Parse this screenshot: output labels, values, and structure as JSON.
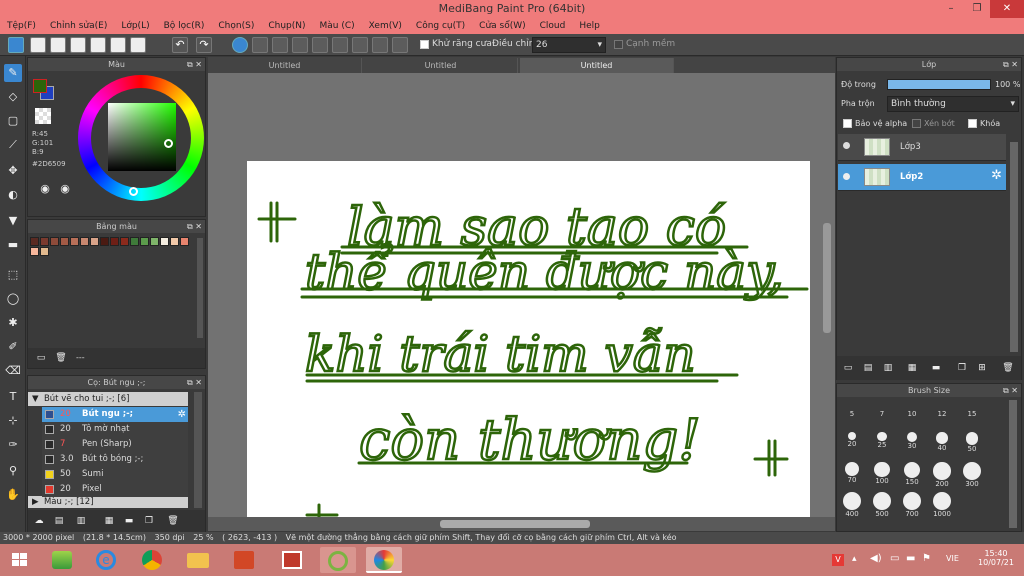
{
  "app": {
    "title": "MediBang Paint Pro (64bit)"
  },
  "window_controls": {
    "minimize": "–",
    "restore": "❐",
    "close": "✕"
  },
  "menu": [
    "Tệp(F)",
    "Chỉnh sửa(E)",
    "Lớp(L)",
    "Bộ lọc(R)",
    "Chọn(S)",
    "Chụp(N)",
    "Màu (C)",
    "Xem(V)",
    "Công cụ(T)",
    "Cửa sổ(W)",
    "Cloud",
    "Help"
  ],
  "toolbar": {
    "antialias_label": "Khử răng cưa",
    "correction_label": "Điều chỉnh",
    "correction_value": "26",
    "edge_label": "Cạnh mềm"
  },
  "color_panel": {
    "title": "Màu",
    "r": "R:45",
    "g": "G:101",
    "b": "B:9",
    "hex": "#2D6509",
    "fg_color": "#2D6509",
    "bg_color": "#1F3FBF"
  },
  "palette_panel": {
    "title": "Bảng màu",
    "more": "---",
    "colors": [
      "#5a2a22",
      "#7a3a2e",
      "#8e4b3a",
      "#a35a45",
      "#b86f58",
      "#c98870",
      "#d9a389",
      "#4a1a12",
      "#6e1f16",
      "#8c2a1c",
      "#3f7a3a",
      "#5c9c4c",
      "#7fb56a",
      "#f4ede0",
      "#f1c8a8",
      "#e8846e",
      "#f7b79c",
      "#e2b98e"
    ]
  },
  "brush_panel": {
    "title": "Cọ: Bút ngu ;-;",
    "group1": "Bút vẽ cho tui ;-; [6]",
    "group2": "Màu ;-; [12]",
    "items": [
      {
        "size": "20",
        "name": "Bút ngu ;-;",
        "color": "#2D4F8F",
        "selected": true
      },
      {
        "size": "20",
        "name": "Tô mờ nhạt",
        "color": "#2a2a2a",
        "selected": false
      },
      {
        "size": "7",
        "name": "Pen (Sharp)",
        "color": "#2a2a2a",
        "selected": false
      },
      {
        "size": "3.0",
        "name": "Bút tô bóng ;-;",
        "color": "#2a2a2a",
        "selected": false
      },
      {
        "size": "50",
        "name": "Sumi",
        "color": "#f2d21b",
        "selected": false
      },
      {
        "size": "20",
        "name": "Pixel",
        "color": "#e23a2e",
        "selected": false
      }
    ]
  },
  "tabs": [
    "Untitled",
    "Untitled",
    "Untitled"
  ],
  "canvas": {
    "ink_color": "#2D6509",
    "lines": [
      "làm sao tao có",
      "thể quên được này,",
      "khi trái tim vẫn",
      "còn thương!"
    ],
    "marks": [
      "+",
      "+",
      "+"
    ]
  },
  "layer_panel": {
    "title": "Lớp",
    "opacity_label": "Độ trong",
    "opacity_value": "100 %",
    "opacity": 1.0,
    "blend_label": "Pha trộn",
    "blend_value": "Bình thường",
    "protect_alpha": "Bảo vệ alpha",
    "clipping": "Xén bớt",
    "lock": "Khóa",
    "layers": [
      {
        "name": "Lớp3",
        "selected": false
      },
      {
        "name": "Lớp2",
        "selected": true
      }
    ]
  },
  "brush_size_panel": {
    "title": "Brush Size",
    "sizes": [
      "5",
      "7",
      "10",
      "12",
      "15",
      "20",
      "25",
      "30",
      "40",
      "50",
      "70",
      "100",
      "150",
      "200",
      "300",
      "400",
      "500",
      "700",
      "1000"
    ]
  },
  "status": {
    "size": "3000 * 2000 pixel",
    "cm": "(21.8 * 14.5cm)",
    "dpi": "350 dpi",
    "zoom": "25 %",
    "coords": "( 2623, -413 )",
    "hint": "Vẽ một đường thẳng bằng cách giữ phím Shift, Thay đổi cỡ cọ bằng cách giữ phím Ctrl, Alt và kéo"
  },
  "taskbar": {
    "lang": "VIE",
    "time": "15:40",
    "date": "10/07/21"
  }
}
